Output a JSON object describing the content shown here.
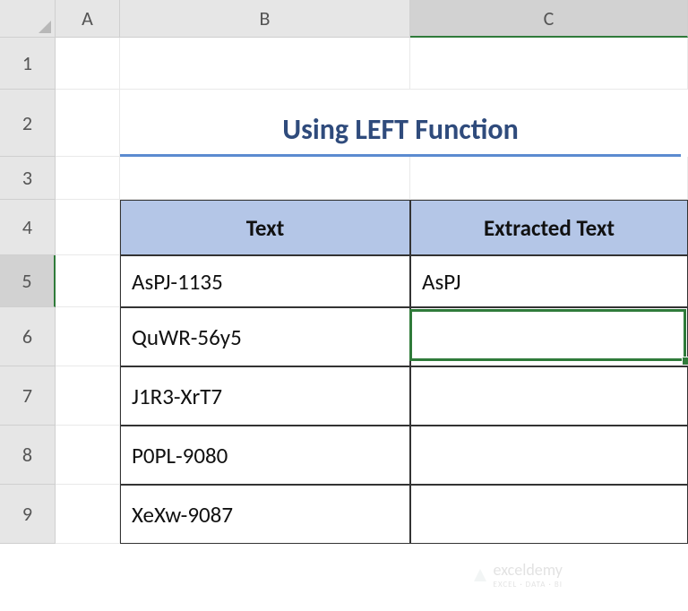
{
  "columns": [
    "A",
    "B",
    "C"
  ],
  "rows": [
    "1",
    "2",
    "3",
    "4",
    "5",
    "6",
    "7",
    "8",
    "9"
  ],
  "selectedCell": "C5",
  "title": "Using LEFT Function",
  "table": {
    "headers": {
      "text": "Text",
      "extracted": "Extracted Text"
    },
    "rows": [
      {
        "text": "AsPJ-1135",
        "extracted": "AsPJ"
      },
      {
        "text": "QuWR-56y5",
        "extracted": ""
      },
      {
        "text": "J1R3-XrT7",
        "extracted": ""
      },
      {
        "text": "P0PL-9080",
        "extracted": ""
      },
      {
        "text": "XeXw-9087",
        "extracted": ""
      }
    ]
  },
  "watermark": {
    "brand": "exceldemy",
    "tagline": "EXCEL · DATA · BI"
  }
}
